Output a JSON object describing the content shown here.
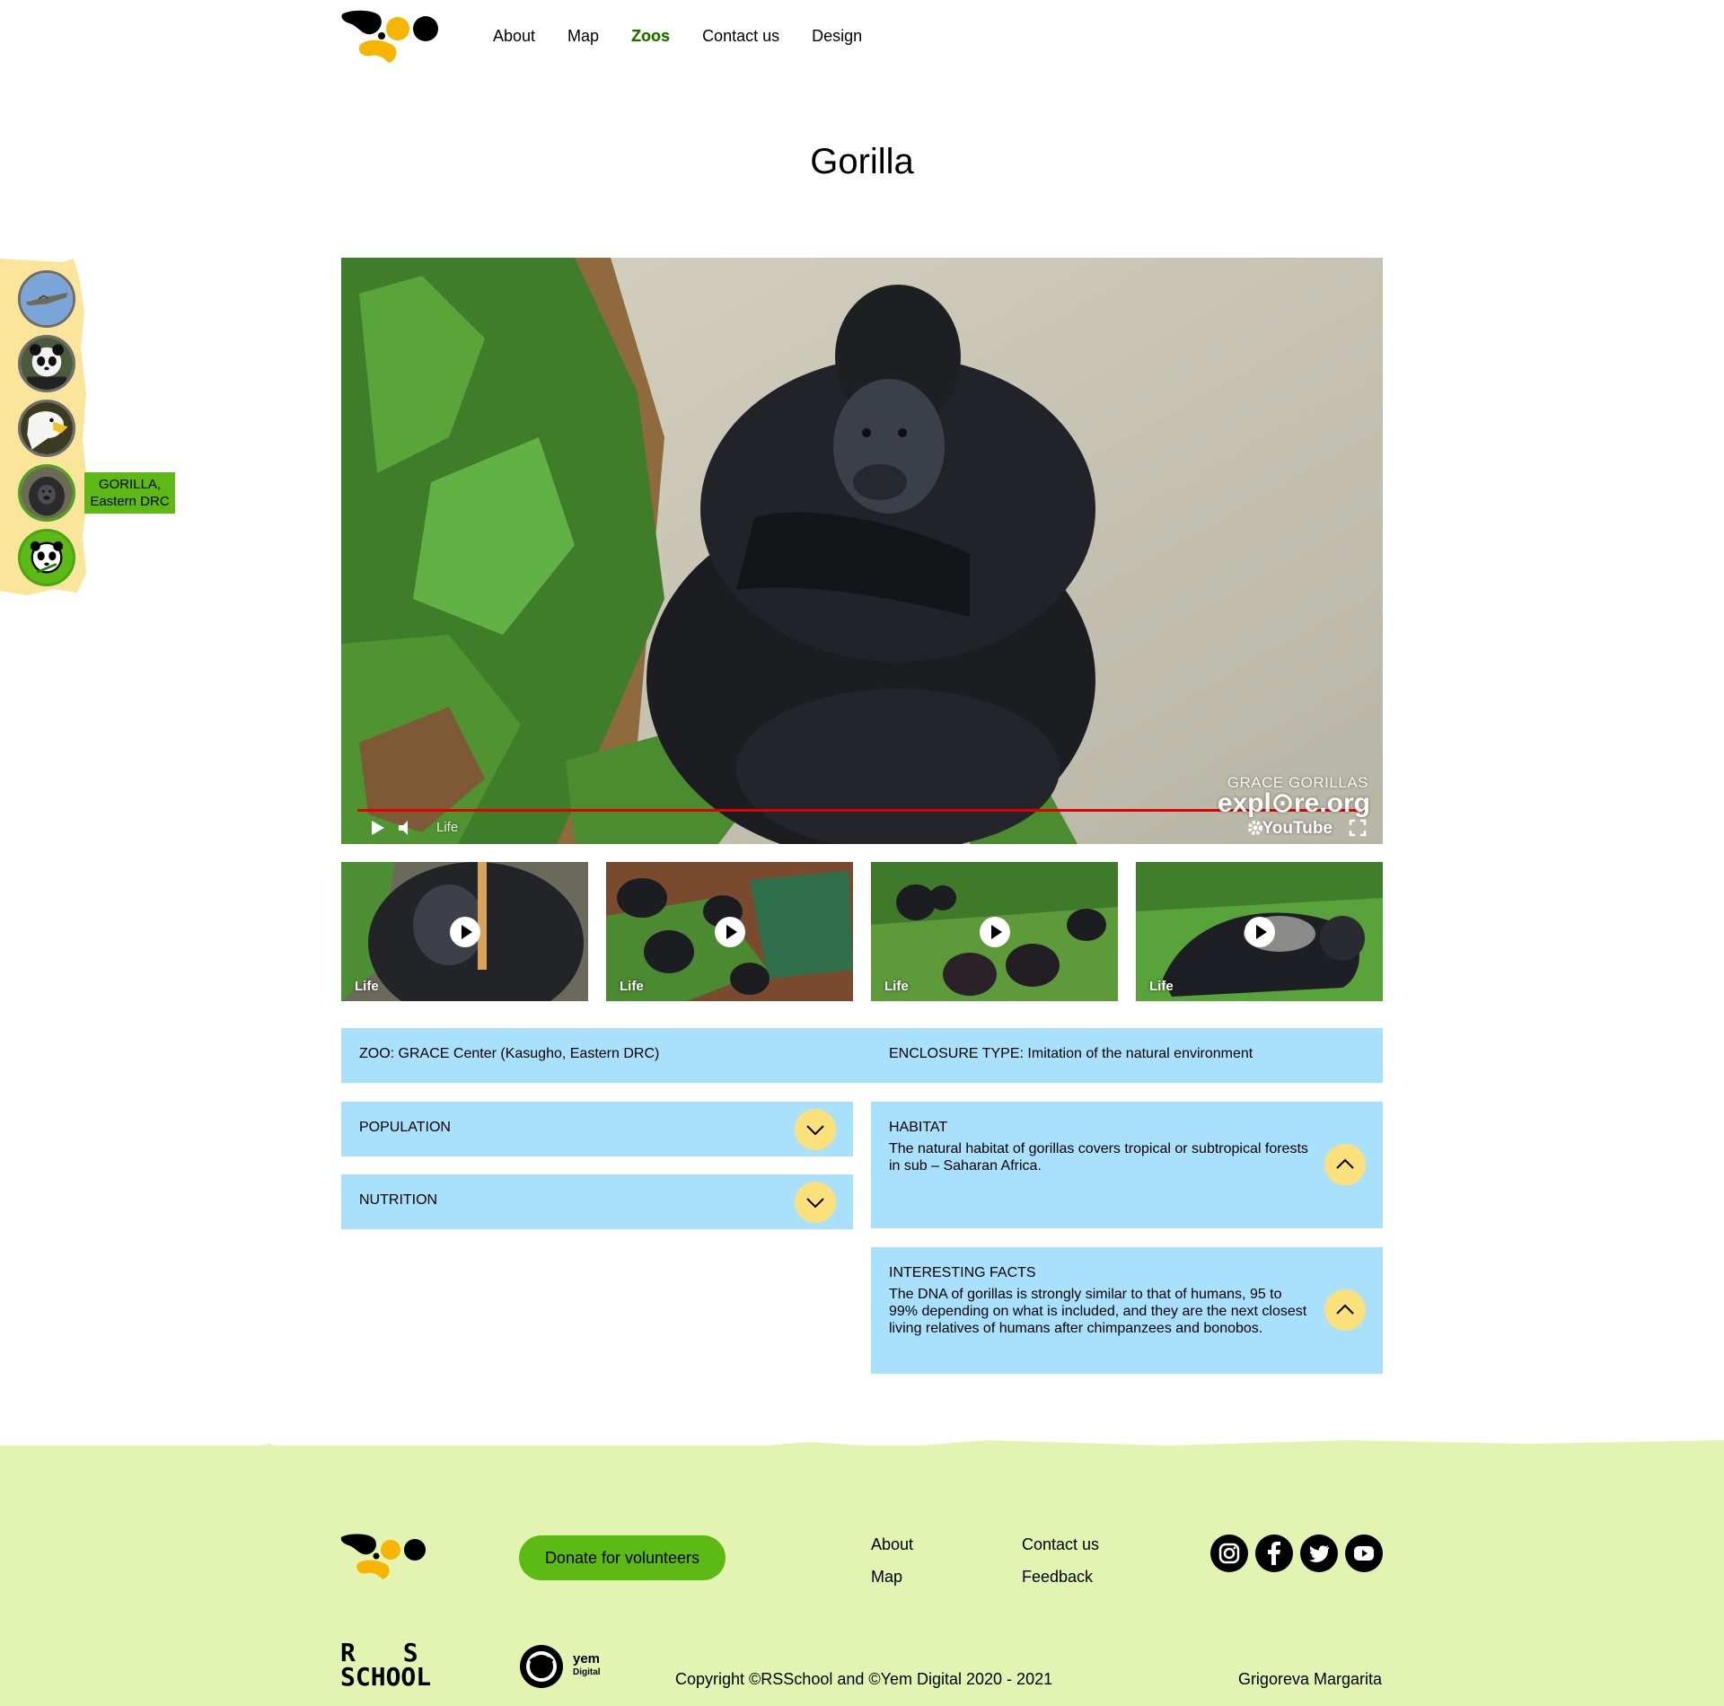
{
  "nav": {
    "items": [
      {
        "label": "About",
        "active": false
      },
      {
        "label": "Map",
        "active": false
      },
      {
        "label": "Zoos",
        "active": true
      },
      {
        "label": "Contact us",
        "active": false
      },
      {
        "label": "Design",
        "active": false
      }
    ]
  },
  "page": {
    "title": "Gorilla"
  },
  "sidebar": {
    "animals": [
      {
        "icon": "alligator-icon",
        "active": false
      },
      {
        "icon": "panda-icon",
        "active": false
      },
      {
        "icon": "eagle-icon",
        "active": false
      },
      {
        "icon": "gorilla-icon",
        "active": true
      },
      {
        "icon": "panda-cartoon-icon",
        "active": false
      }
    ],
    "tooltip_line1": "GORILLA,",
    "tooltip_line2": "Eastern DRC"
  },
  "video": {
    "brand": "GRACE GORILLAS",
    "site": "expl⊙re.org",
    "platform": "YouTube",
    "label": "Life"
  },
  "thumbnails": [
    {
      "label": "Life"
    },
    {
      "label": "Life"
    },
    {
      "label": "Life"
    },
    {
      "label": "Life"
    }
  ],
  "info": {
    "zoo": "ZOO: GRACE Center (Kasugho, Eastern DRC)",
    "enclosure": "ENCLOSURE TYPE: Imitation of the natural environment"
  },
  "panels": {
    "population": {
      "title": "POPULATION"
    },
    "nutrition": {
      "title": "NUTRITION"
    },
    "habitat": {
      "title": "HABITAT",
      "text": "The natural habitat of gorillas covers tropical or subtropical forests in sub – Saharan Africa."
    },
    "facts": {
      "title": "INTERESTING FACTS",
      "text": "The DNA of gorillas is strongly similar to that of humans, 95 to 99% depending on what is included, and they are the next closest living relatives of humans after chimpanzees and bonobos."
    }
  },
  "footer": {
    "donate_label": "Donate for volunteers",
    "links": {
      "about": "About",
      "map": "Map",
      "contact": "Contact us",
      "feedback": "Feedback"
    },
    "social": [
      "instagram-icon",
      "facebook-icon",
      "twitter-icon",
      "youtube-icon"
    ],
    "rs_line1": "R S",
    "rs_line2": "SCHOOL",
    "yem_line1": "yem",
    "yem_line2": "Digital",
    "copyright": "Copyright ©RSSchool and ©Yem Digital 2020 - 2021",
    "author": "Grigoreva Margarita"
  },
  "colors": {
    "accent_green": "#5dba15",
    "info_blue": "#a9e0fc",
    "toggle_yellow": "#fbe17b",
    "footer_green": "#e2f3b2",
    "sidebar_yellow": "#fbe59b"
  }
}
